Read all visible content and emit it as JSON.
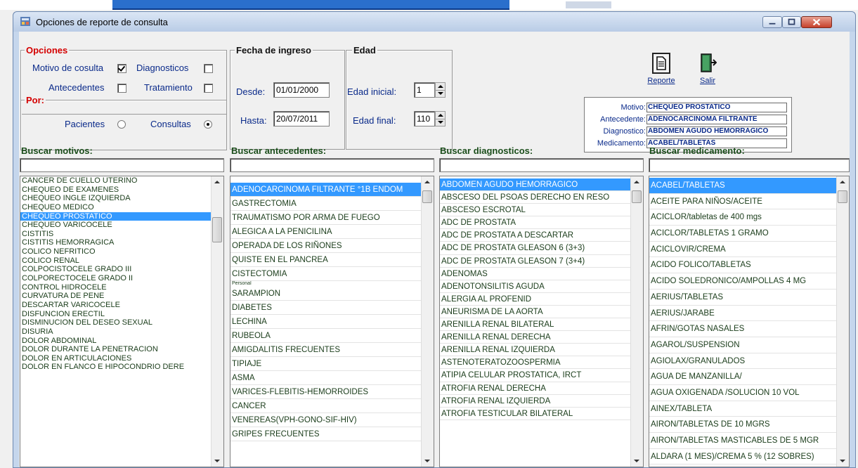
{
  "window": {
    "title": "Opciones de reporte de consulta"
  },
  "opciones": {
    "label": "Opciones",
    "motivo": {
      "label": "Motivo de cosulta",
      "checked": true
    },
    "diagnosticos": {
      "label": "Diagnosticos",
      "checked": false
    },
    "antecedentes": {
      "label": "Antecedentes",
      "checked": false
    },
    "tratamiento": {
      "label": "Tratamiento",
      "checked": false
    }
  },
  "por": {
    "label": "Por:",
    "pacientes": {
      "label": "Pacientes",
      "selected": false
    },
    "consultas": {
      "label": "Consultas",
      "selected": true
    }
  },
  "fecha": {
    "label": "Fecha de ingreso",
    "desde_label": "Desde:",
    "desde": "01/01/2000",
    "hasta_label": "Hasta:",
    "hasta": "20/07/2011"
  },
  "edad": {
    "label": "Edad",
    "inicial_label": "Edad inicial:",
    "inicial": "1",
    "final_label": "Edad final:",
    "final": "110"
  },
  "toolbar": {
    "reporte_label": "Reporte",
    "salir_label": "Salir"
  },
  "summary": {
    "motivo_label": "Motivo:",
    "motivo": "CHEQUEO PROSTATICO",
    "antecedente_label": "Antecedente:",
    "antecedente": "ADENOCARCINOMA FILTRANTE",
    "diagnostico_label": "Diagnostico:",
    "diagnostico": "ABDOMEN AGUDO HEMORRAGICO",
    "medicamento_label": "Medicamento:",
    "medicamento": "ACABEL/TABLETAS"
  },
  "columns": {
    "motivos": {
      "header": "Buscar motivos:",
      "selected_index": 4,
      "items": [
        "CANCER DE CUELLO UTERINO",
        "CHEQUEO DE EXAMENES",
        "CHEQUEO INGLE IZQUIERDA",
        "CHEQUEO MEDICO",
        "CHEQUEO PROSTATICO",
        "CHEQUEO VARICOCELE",
        "CISTITIS",
        "CISTITIS HEMORRAGICA",
        "COLICO NEFRITICO",
        "COLICO RENAL",
        "COLPOCISTOCELE GRADO III",
        "COLPORECTOCELE GRADO II",
        "CONTROL HIDROCELE",
        "CURVATURA DE PENE",
        "DESCARTAR VARICOCELE",
        "DISFUNCION ERECTIL",
        "DISMINUCION DEL DESEO SEXUAL",
        "DISURIA",
        "DOLOR ABDOMINAL",
        "DOLOR DURANTE LA PENETRACION",
        "DOLOR EN ARTICULACIONES",
        "DOLOR EN FLANCO E HIPOCONDRIO DERE"
      ]
    },
    "antecedentes": {
      "header": "Buscar antecedentes:",
      "selected_index": 0,
      "items": [
        "ADENOCARCINOMA FILTRANTE °1B ENDOM",
        "GASTRECTOMIA",
        "TRAUMATISMO POR ARMA DE FUEGO",
        "ALEGICA A LA PENICILINA",
        "OPERADA DE LOS RIÑONES",
        "QUISTE EN EL PANCREA",
        "CISTECTOMIA",
        "Personal",
        "SARAMPION",
        "DIABETES",
        "LECHINA",
        "RUBEOLA",
        "AMIGDALITIS FRECUENTES",
        "TIPIAJE",
        "ASMA",
        "VARICES-FLEBITIS-HEMORROIDES",
        "CANCER",
        "VENEREAS(VPH-GONO-SIF-HIV)",
        "GRIPES FRECUENTES"
      ]
    },
    "diagnosticos": {
      "header": "Buscar diagnosticos:",
      "selected_index": 0,
      "items": [
        "ABDOMEN AGUDO HEMORRAGICO",
        "ABSCESO  DEL PSOAS DERECHO EN RESO",
        "ABSCESO ESCROTAL",
        "ADC DE PROSTATA",
        "ADC DE PROSTATA A DESCARTAR",
        "ADC DE PROSTATA GLEASON 6 (3+3)",
        "ADC DE PROSTATA GLEASON 7 (3+4)",
        "ADENOMAS",
        "ADENOTONSILITIS AGUDA",
        "ALERGIA AL PROFENID",
        "ANEURISMA DE LA AORTA",
        "ARENILLA RENAL BILATERAL",
        "ARENILLA RENAL DERECHA",
        "ARENILLA RENAL IZQUIERDA",
        "ASTENOTERATOZOOSPERMIA",
        "ATIPIA CELULAR PROSTATICA, IRCT",
        "ATROFIA RENAL DERECHA",
        "ATROFIA RENAL IZQUIERDA",
        "ATROFIA TESTICULAR BILATERAL"
      ]
    },
    "medicamento": {
      "header": "Buscar medicamento:",
      "selected_index": 0,
      "items": [
        "ACABEL/TABLETAS",
        "ACEITE PARA NIÑOS/ACEITE",
        "ACICLOR/tabletas de 400 mgs",
        "ACICLOR/TABLETAS 1 GRAMO",
        "ACICLOVIR/CREMA",
        "ACIDO FOLICO/TABLETAS",
        "ACIDO SOLEDRONICO/AMPOLLAS 4 MG",
        "AERIUS/TABLETAS",
        "AERIUS/JARABE",
        "AFRIN/GOTAS NASALES",
        "AGAROL/SUSPENSION",
        "AGIOLAX/GRANULADOS",
        "AGUA DE MANZANILLA/",
        "AGUA OXIGENADA /SOLUCION 10 VOL",
        "AINEX/TABLETA",
        "AIRON/TABLETAS DE 10 MGRS",
        "AIRON/TABLETAS MASTICABLES DE 5 MGR",
        "ALDARA (1 MES)/CREMA 5 % (12 SOBRES)"
      ]
    }
  }
}
